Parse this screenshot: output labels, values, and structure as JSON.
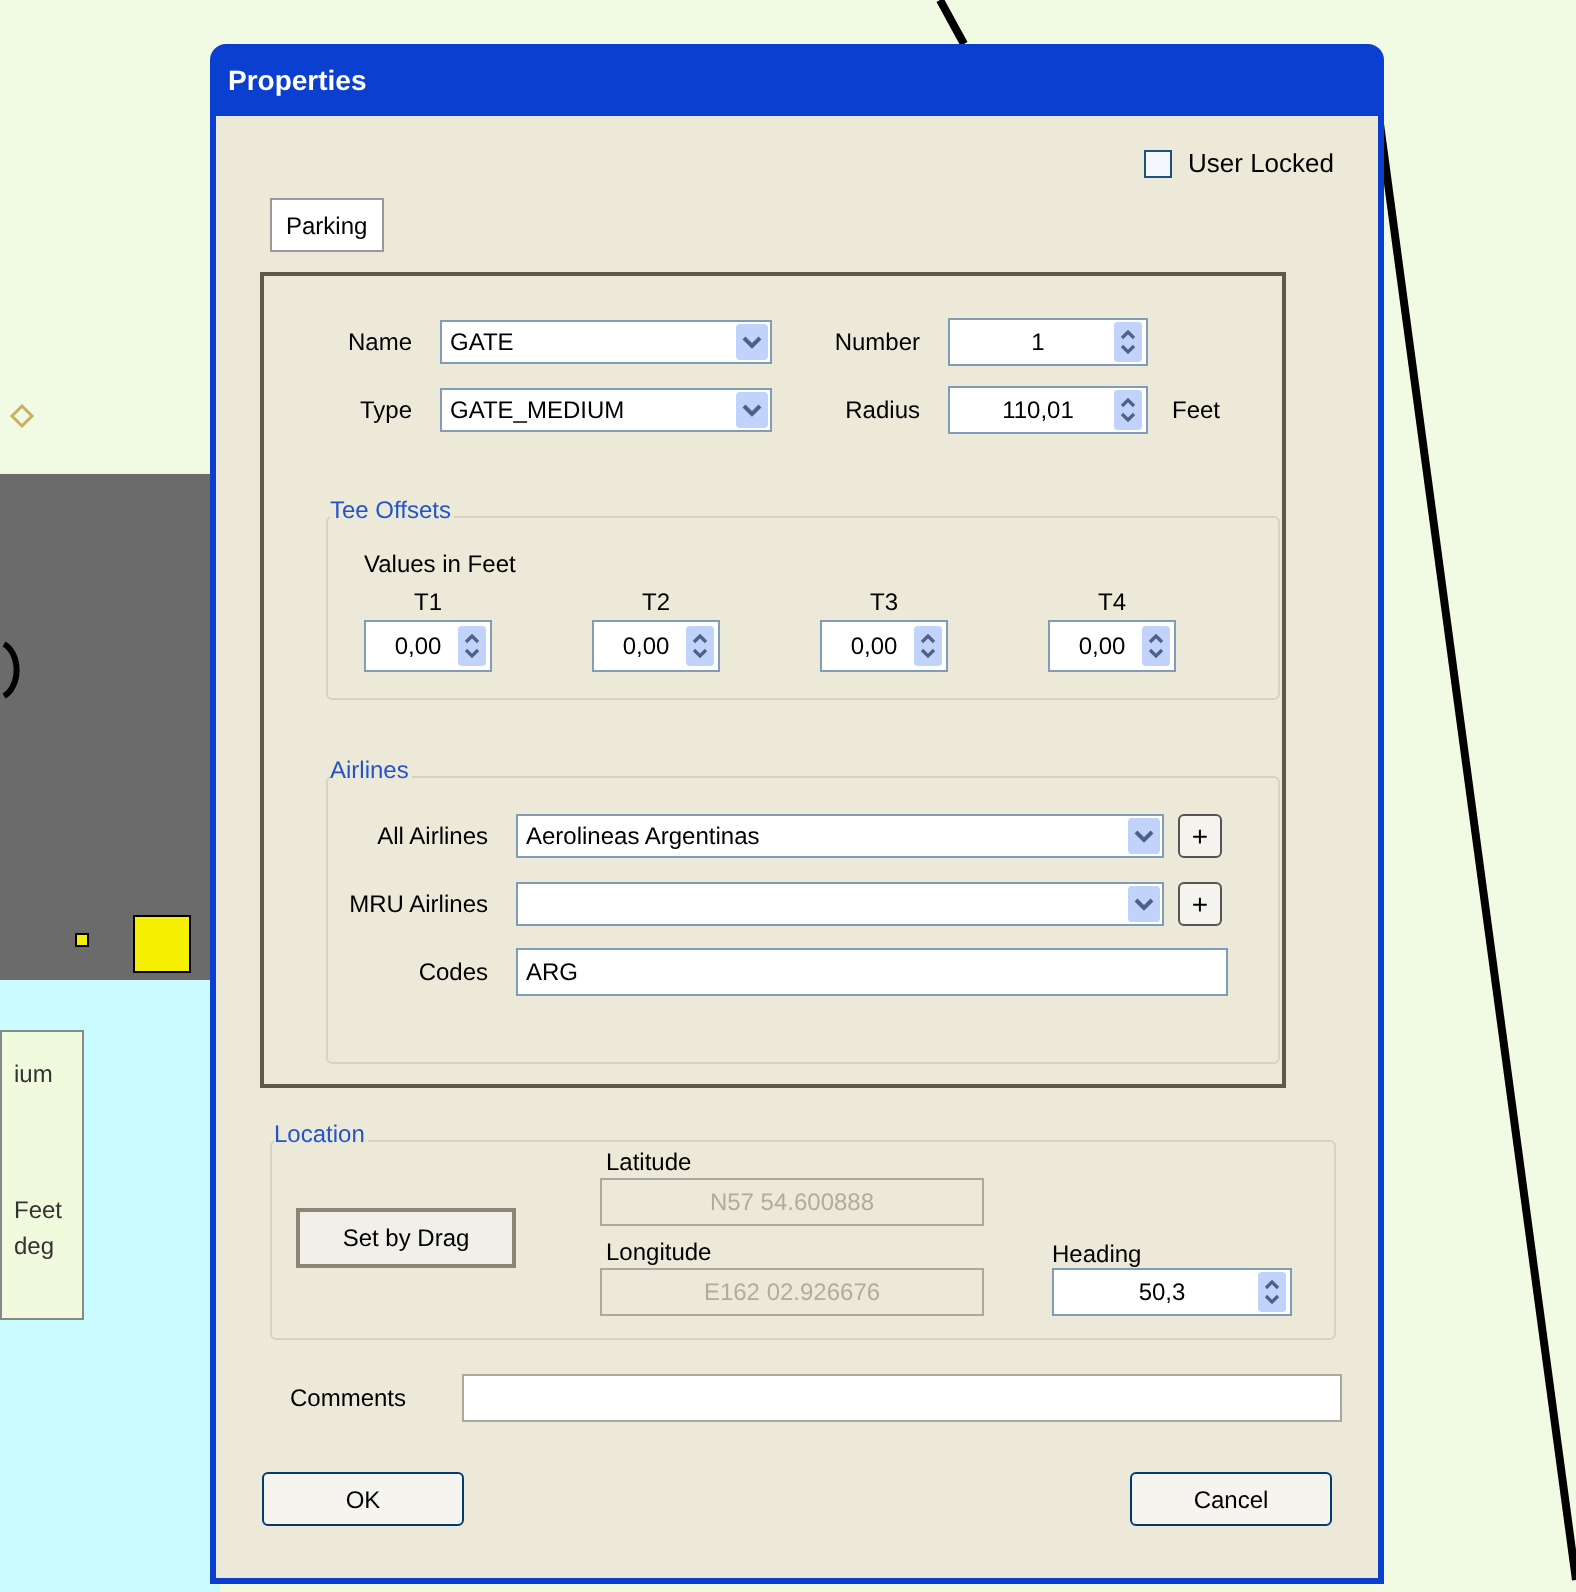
{
  "canvas_labels": [
    "ium",
    "Feet",
    "deg"
  ],
  "window": {
    "title": "Properties"
  },
  "user_locked": {
    "label": "User Locked",
    "checked": false
  },
  "tabs": [
    {
      "label": "Parking",
      "selected": true
    }
  ],
  "name": {
    "label": "Name",
    "value": "GATE"
  },
  "number": {
    "label": "Number",
    "value": "1"
  },
  "type": {
    "label": "Type",
    "value": "GATE_MEDIUM"
  },
  "radius": {
    "label": "Radius",
    "value": "110,01",
    "unit": "Feet"
  },
  "tee_offsets": {
    "title": "Tee Offsets",
    "subtitle": "Values in Feet",
    "items": [
      {
        "label": "T1",
        "value": "0,00"
      },
      {
        "label": "T2",
        "value": "0,00"
      },
      {
        "label": "T3",
        "value": "0,00"
      },
      {
        "label": "T4",
        "value": "0,00"
      }
    ]
  },
  "airlines": {
    "title": "Airlines",
    "rows": [
      {
        "kind": "combo",
        "label": "All Airlines",
        "value": "Aerolineas Argentinas",
        "add_button": "+"
      },
      {
        "kind": "combo",
        "label": "MRU Airlines",
        "add_button": "+"
      },
      {
        "kind": "text",
        "label": "Codes",
        "value": "ARG"
      }
    ]
  },
  "location": {
    "title": "Location",
    "set_button": "Set by Drag",
    "latitude": {
      "label": "Latitude",
      "value": "N57 54.600888",
      "disabled": true
    },
    "longitude": {
      "label": "Longitude",
      "value": "E162 02.926676",
      "disabled": true
    },
    "heading": {
      "label": "Heading",
      "value": "50,3"
    }
  },
  "comments": {
    "label": "Comments"
  },
  "buttons": [
    "OK",
    "Cancel"
  ]
}
